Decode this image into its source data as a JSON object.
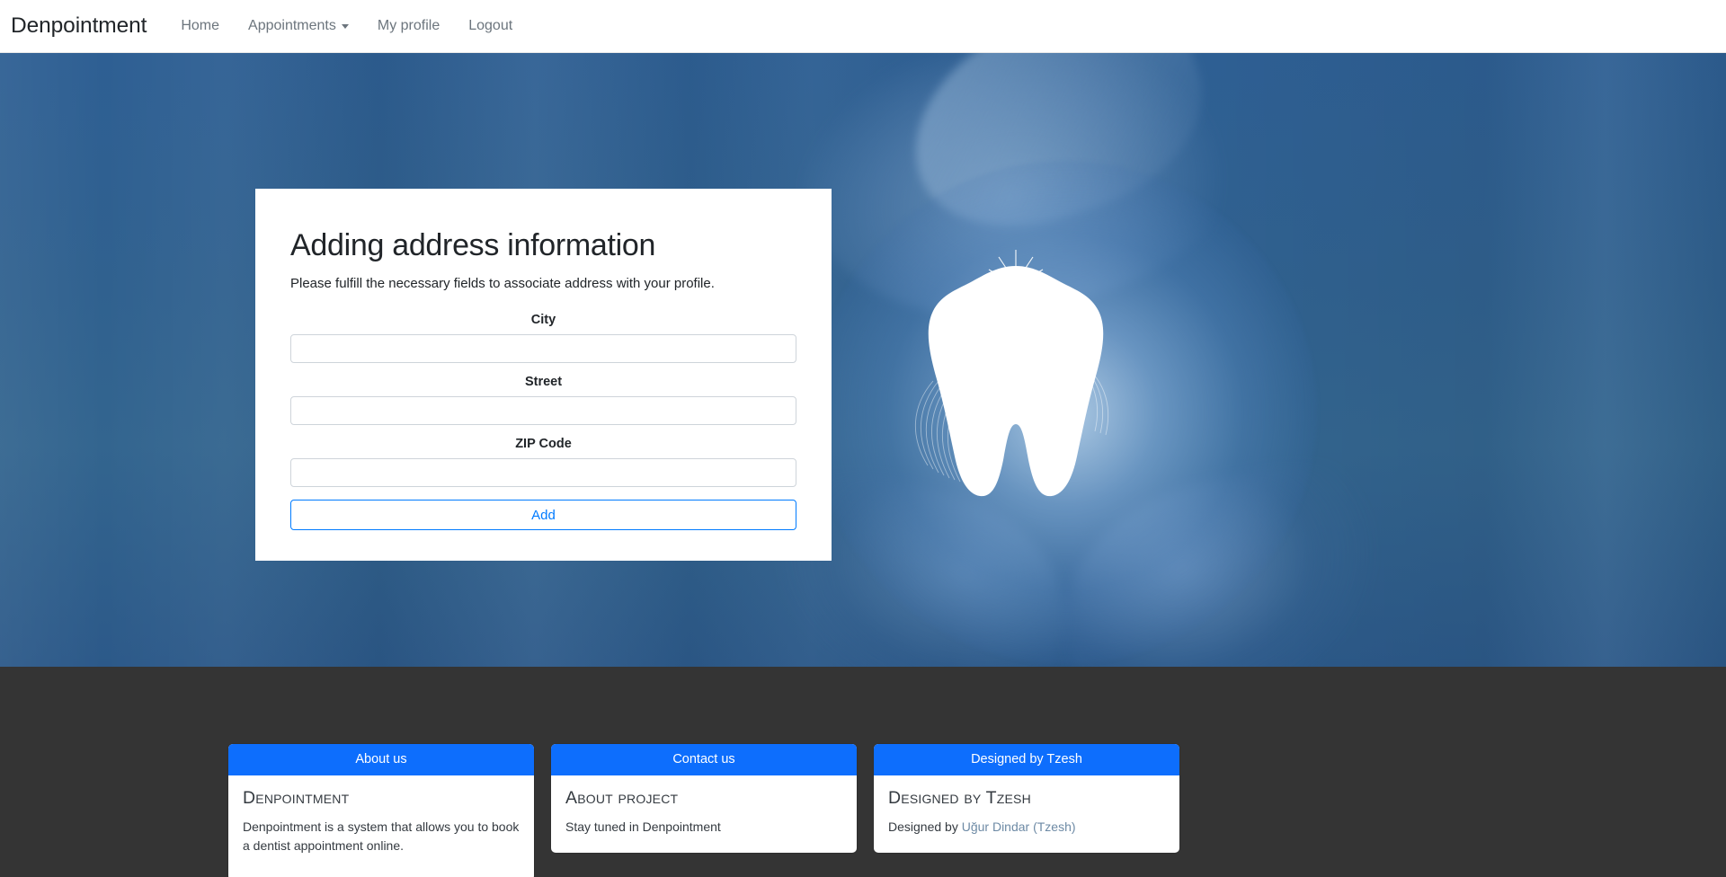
{
  "navbar": {
    "brand": "Denpointment",
    "links": [
      {
        "label": "Home",
        "has_caret": false
      },
      {
        "label": "Appointments",
        "has_caret": true
      },
      {
        "label": "My profile",
        "has_caret": false
      },
      {
        "label": "Logout",
        "has_caret": false
      }
    ]
  },
  "form_card": {
    "title": "Adding address information",
    "subtitle": "Please fulfill the necessary fields to associate address with your profile.",
    "fields": [
      {
        "label": "City",
        "value": "",
        "placeholder": ""
      },
      {
        "label": "Street",
        "value": "",
        "placeholder": ""
      },
      {
        "label": "ZIP Code",
        "value": "",
        "placeholder": ""
      }
    ],
    "submit_label": "Add"
  },
  "hero": {
    "background_color": "#2d5d90",
    "image_description": "gloved-hands-holding-tooth"
  },
  "footer": {
    "background_color": "#343434",
    "accent_color": "#0d6efd",
    "cards": [
      {
        "header": "About us",
        "title": "Denpointment",
        "text": "Denpointment is a system that allows you to book a dentist appointment online.",
        "link_prefix": "",
        "link_text": ""
      },
      {
        "header": "Contact us",
        "title": "About project",
        "text": "Stay tuned in Denpointment",
        "link_prefix": "",
        "link_text": ""
      },
      {
        "header": "Designed by Tzesh",
        "title": "Designed by Tzesh",
        "text": "",
        "link_prefix": "Designed by ",
        "link_text": "Uğur Dindar (Tzesh)"
      }
    ]
  }
}
